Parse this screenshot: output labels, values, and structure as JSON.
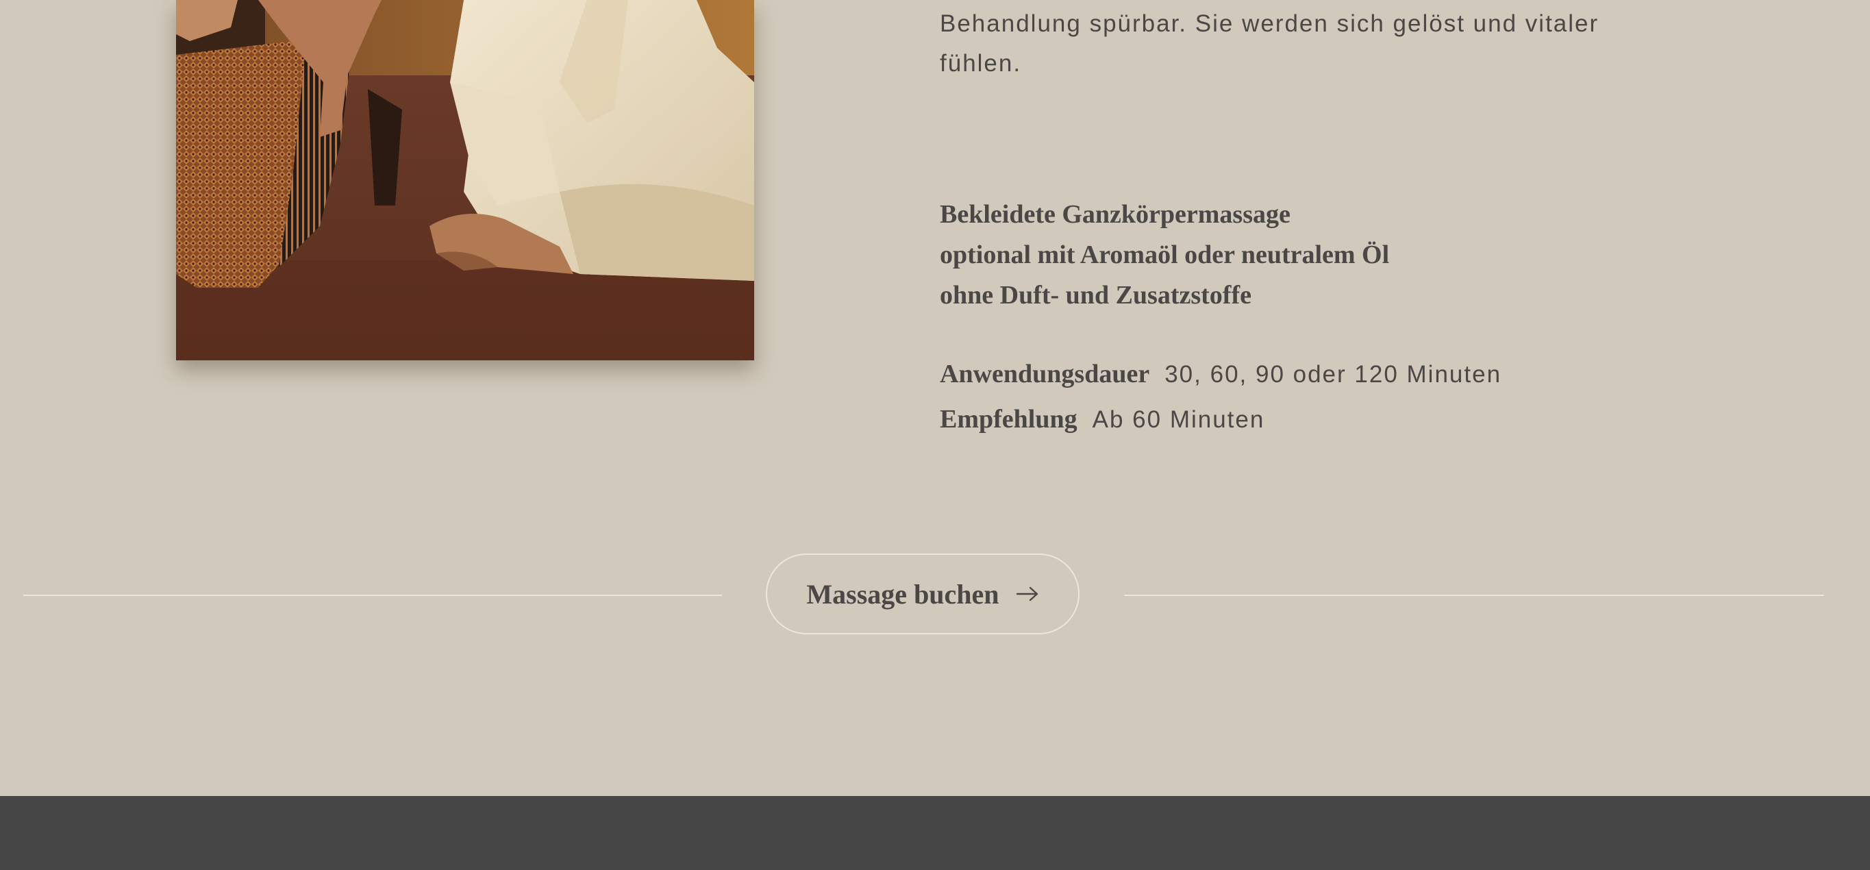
{
  "colors": {
    "page_background": "#d1c9bb",
    "text": "#4a4846",
    "rule": "#ece6dc",
    "footer": "#464646"
  },
  "image": {
    "subject": "thai-massage-photo"
  },
  "description": {
    "line1": "Behandlung spürbar. Sie werden sich gelöst und vitaler",
    "line2": "fühlen."
  },
  "features": [
    "Bekleidete Ganzkörpermassage",
    "optional mit Aromaöl oder neutralem Öl",
    "ohne Duft- und Zusatzstoffe"
  ],
  "specs": {
    "duration_label": "Anwendungsdauer",
    "duration_value": "30, 60, 90 oder 120 Minuten",
    "recommendation_label": "Empfehlung",
    "recommendation_value": "Ab 60 Minuten"
  },
  "cta": {
    "label": "Massage buchen",
    "icon": "arrow-right-icon"
  }
}
